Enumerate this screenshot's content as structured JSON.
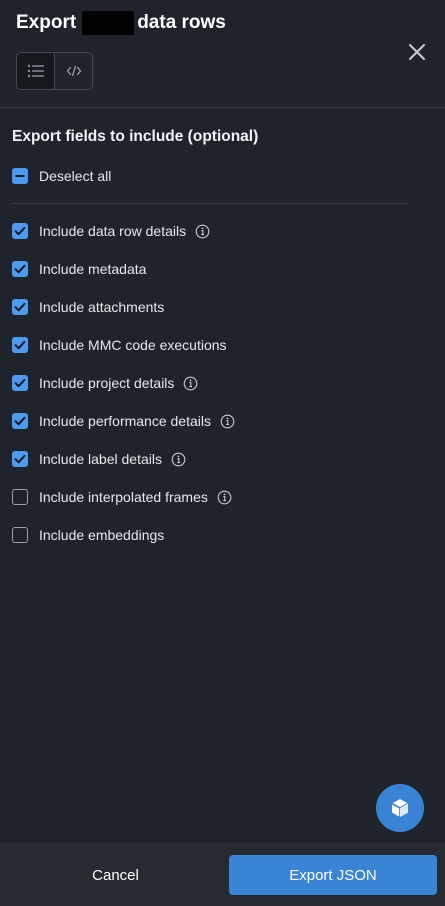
{
  "header": {
    "title_prefix": "Export",
    "title_suffix": "data rows",
    "close_icon": "close-icon",
    "view_toggle": {
      "options": [
        "list-icon",
        "code-icon"
      ],
      "active": "list-icon"
    }
  },
  "fields": {
    "title": "Export fields to include (optional)",
    "deselect_all": {
      "label": "Deselect all",
      "state": "indeterminate"
    },
    "items": [
      {
        "label": "Include data row details",
        "checked": true,
        "info": true
      },
      {
        "label": "Include metadata",
        "checked": true,
        "info": false
      },
      {
        "label": "Include attachments",
        "checked": true,
        "info": false
      },
      {
        "label": "Include MMC code executions",
        "checked": true,
        "info": false
      },
      {
        "label": "Include project details",
        "checked": true,
        "info": true
      },
      {
        "label": "Include performance details",
        "checked": true,
        "info": true
      },
      {
        "label": "Include label details",
        "checked": true,
        "info": true
      },
      {
        "label": "Include interpolated frames",
        "checked": false,
        "info": true
      },
      {
        "label": "Include embeddings",
        "checked": false,
        "info": false
      }
    ]
  },
  "footer": {
    "cancel_label": "Cancel",
    "export_label": "Export JSON"
  },
  "colors": {
    "background": "#1f232b",
    "accent": "#3a84d6",
    "checkbox": "#4d9bf0",
    "footer": "#262a31"
  },
  "fab_icon": "cube-icon"
}
